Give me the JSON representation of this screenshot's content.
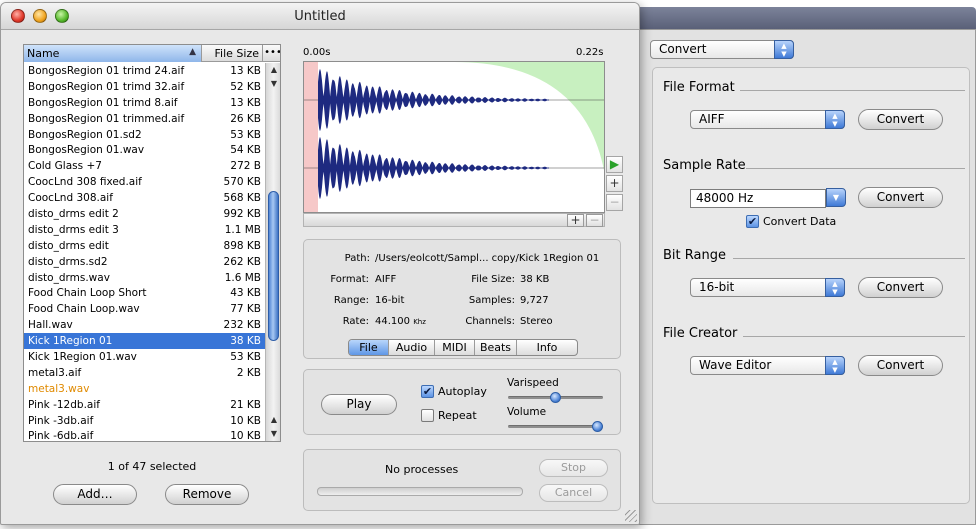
{
  "window": {
    "title": "Untitled"
  },
  "file_list": {
    "col_name": "Name",
    "col_size": "File Size",
    "col_more": "•••",
    "rows": [
      {
        "name": "BongosRegion 01 trimd 24.aif",
        "size": "13 KB"
      },
      {
        "name": "BongosRegion 01 trimd 32.aif",
        "size": "52 KB"
      },
      {
        "name": "BongosRegion 01 trimd 8.aif",
        "size": "13 KB"
      },
      {
        "name": "BongosRegion 01 trimmed.aif",
        "size": "26 KB"
      },
      {
        "name": "BongosRegion 01.sd2",
        "size": "53 KB"
      },
      {
        "name": "BongosRegion 01.wav",
        "size": "54 KB"
      },
      {
        "name": "Cold Glass +7",
        "size": "272 B"
      },
      {
        "name": "CoocLnd 308 fixed.aif",
        "size": "570 KB"
      },
      {
        "name": "CoocLnd 308.aif",
        "size": "568 KB"
      },
      {
        "name": "disto_drms edit 2",
        "size": "992 KB"
      },
      {
        "name": "disto_drms edit 3",
        "size": "1.1 MB"
      },
      {
        "name": "disto_drms edit",
        "size": "898 KB"
      },
      {
        "name": "disto_drms.sd2",
        "size": "262 KB"
      },
      {
        "name": "disto_drms.wav",
        "size": "1.6 MB"
      },
      {
        "name": "Food Chain Loop Short",
        "size": "43 KB"
      },
      {
        "name": "Food Chain Loop.wav",
        "size": "77 KB"
      },
      {
        "name": "Hall.wav",
        "size": "232 KB"
      },
      {
        "name": "Kick 1Region 01",
        "size": "38 KB"
      },
      {
        "name": "Kick 1Region 01.wav",
        "size": "53 KB"
      },
      {
        "name": "metal3.aif",
        "size": "2 KB"
      },
      {
        "name": "metal3.wav",
        "size": ""
      },
      {
        "name": "Pink -12db.aif",
        "size": "21 KB"
      },
      {
        "name": "Pink -3db.aif",
        "size": "10 KB"
      },
      {
        "name": "Pink -6db.aif",
        "size": "10 KB"
      }
    ],
    "selected_index": 17,
    "pending_index": 20,
    "selection_text": "1 of 47 selected",
    "add_label": "Add…",
    "remove_label": "Remove"
  },
  "waveform": {
    "start_time": "0.00s",
    "end_time": "0.22s"
  },
  "info": {
    "path_label": "Path:",
    "path_value": "/Users/eolcott/Sampl... copy/Kick 1Region 01",
    "format_label": "Format:",
    "format_value": "AIFF",
    "filesize_label": "File Size:",
    "filesize_value": "38 KB",
    "range_label": "Range:",
    "range_value": "16-bit",
    "samples_label": "Samples:",
    "samples_value": "9,727",
    "rate_label": "Rate:",
    "rate_value": "44.100",
    "rate_unit": "Khz",
    "channels_label": "Channels:",
    "channels_value": "Stereo",
    "tabs": [
      "File",
      "Audio",
      "MIDI",
      "Beats",
      "Info"
    ],
    "active_tab": "File"
  },
  "playback": {
    "play_label": "Play",
    "autoplay_label": "Autoplay",
    "autoplay_checked": true,
    "repeat_label": "Repeat",
    "repeat_checked": false,
    "varispeed_label": "Varispeed",
    "varispeed_value": 0.5,
    "volume_label": "Volume",
    "volume_value": 0.95
  },
  "processes": {
    "status_text": "No processes",
    "stop_label": "Stop",
    "cancel_label": "Cancel"
  },
  "converter": {
    "mode_value": "Convert",
    "file_format_title": "File Format",
    "file_format_value": "AIFF",
    "sample_rate_title": "Sample Rate",
    "sample_rate_value": "48000 Hz",
    "convert_data_label": "Convert Data",
    "convert_data_checked": true,
    "bit_range_title": "Bit Range",
    "bit_range_value": "16-bit",
    "file_creator_title": "File Creator",
    "file_creator_value": "Wave Editor",
    "convert_label": "Convert"
  },
  "colors": {
    "selection": "#3875d7",
    "pending_text": "#e08a00",
    "waveform": "#1e2a80",
    "fade_in": "#f6c8c8",
    "fade_out": "#c8f0c0"
  },
  "icons": {
    "play_icon": "▶",
    "zoom_in_icon": "+",
    "zoom_out_icon": "−",
    "scroll_up_icon": "▲",
    "scroll_down_icon": "▼",
    "sort_arrow_icon": "▲",
    "checkmark_icon": "✔"
  }
}
